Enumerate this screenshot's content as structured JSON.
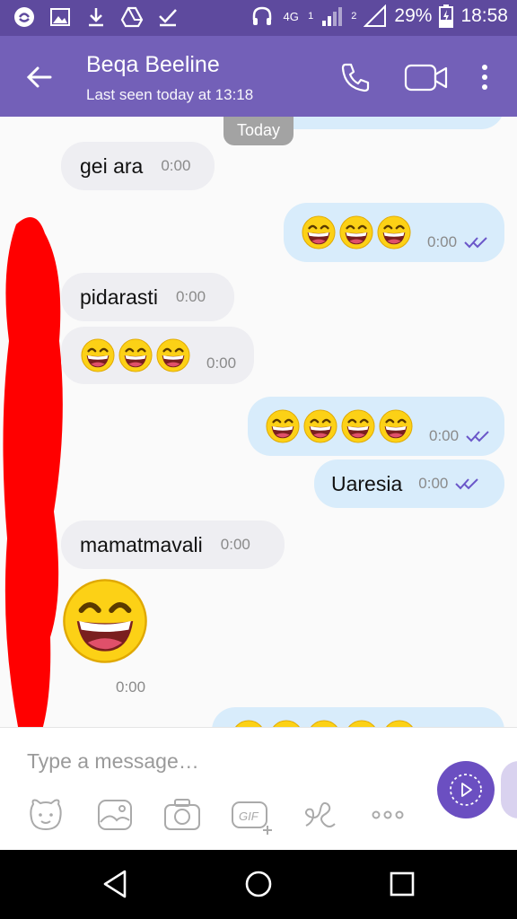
{
  "status_bar": {
    "network": "4G",
    "sim1": "1",
    "sim2": "2",
    "battery": "29%",
    "time": "18:58"
  },
  "header": {
    "contact_name": "Beqa Beeline",
    "last_seen": "Last seen today at 13:18"
  },
  "chat": {
    "date_chip": "Today",
    "messages": [
      {
        "direction": "in",
        "text": "gei ara",
        "time": "0:00"
      },
      {
        "direction": "out",
        "emoji": "laughing-face",
        "emoji_count": 3,
        "time": "0:00",
        "ticks": "double-check"
      },
      {
        "direction": "in",
        "text": "pidarasti",
        "time": "0:00"
      },
      {
        "direction": "in",
        "emoji": "laughing-face",
        "emoji_count": 3,
        "time": "0:00"
      },
      {
        "direction": "out",
        "emoji": "laughing-face",
        "emoji_count": 4,
        "time": "0:00",
        "ticks": "double-check"
      },
      {
        "direction": "out",
        "text": "Uaresia",
        "time": "0:00",
        "ticks": "double-check"
      },
      {
        "direction": "in",
        "text": "mamatmavali",
        "time": "0:00"
      },
      {
        "direction": "in",
        "emoji": "laughing-face-large",
        "time": "0:00"
      },
      {
        "direction": "out",
        "emoji": "laughing-face",
        "emoji_count": 5
      }
    ]
  },
  "input": {
    "placeholder": "Type a message…",
    "tools": [
      "sticker-icon",
      "gallery-icon",
      "camera-icon",
      "gif-icon",
      "doodle-icon",
      "more-icon"
    ]
  },
  "colors": {
    "header": "#7360b8",
    "status_bar": "#5e4a9e",
    "incoming_bubble": "#eeeef2",
    "outgoing_bubble": "#d8ecfb",
    "accent": "#6b4fc1"
  }
}
